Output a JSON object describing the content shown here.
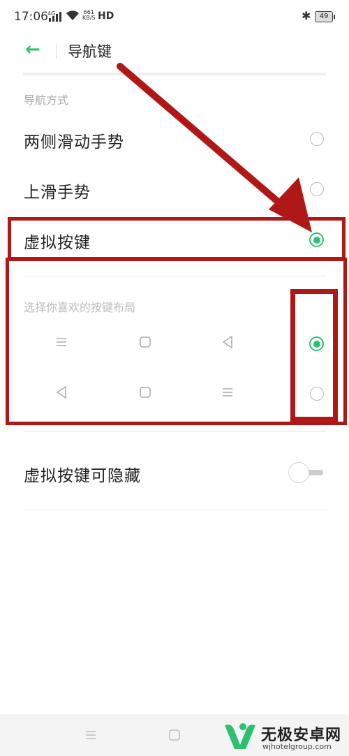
{
  "status_bar": {
    "time": "17:06",
    "network": "4G",
    "speed_value": "661",
    "speed_unit": "KB/S",
    "hd": "HD",
    "battery": "49"
  },
  "header": {
    "title": "导航键"
  },
  "navigation_mode": {
    "section_label": "导航方式",
    "options": [
      {
        "label": "两侧滑动手势",
        "selected": false
      },
      {
        "label": "上滑手势",
        "selected": false
      },
      {
        "label": "虚拟按键",
        "selected": true
      }
    ]
  },
  "button_layout": {
    "section_label": "选择你喜欢的按键布局",
    "layouts": [
      {
        "icons": [
          "menu-icon",
          "square-icon",
          "triangle-back-icon"
        ],
        "selected": true
      },
      {
        "icons": [
          "triangle-back-icon",
          "square-icon",
          "menu-icon"
        ],
        "selected": false
      }
    ]
  },
  "hide_virtual_keys": {
    "label": "虚拟按键可隐藏",
    "enabled": false
  },
  "watermark": {
    "name": "无极安卓网",
    "url": "wjhotelgroup.com"
  },
  "colors": {
    "accent": "#2fbf71",
    "annotation": "#b01818"
  }
}
